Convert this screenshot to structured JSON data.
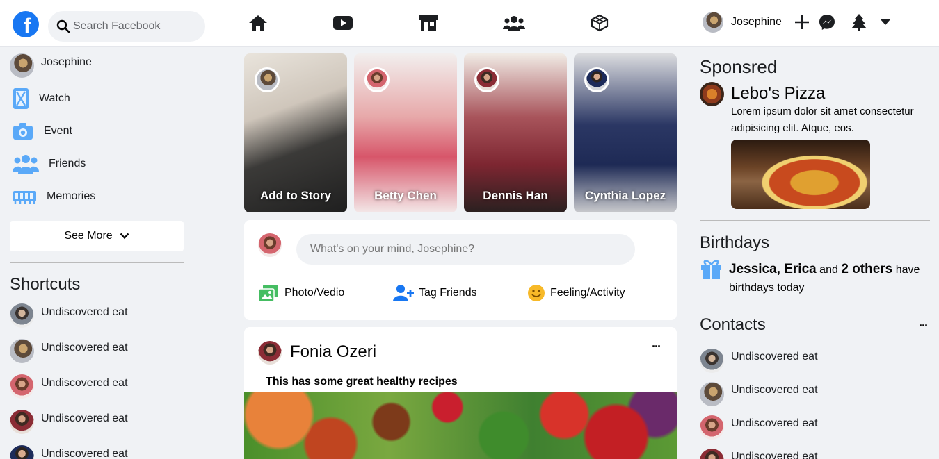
{
  "brand": {
    "logo_letter": "f",
    "color": "#1877f2"
  },
  "search": {
    "placeholder": "Search Facebook"
  },
  "nav": [
    {
      "icon": "home-icon"
    },
    {
      "icon": "video-icon"
    },
    {
      "icon": "marketplace-icon"
    },
    {
      "icon": "groups-icon"
    },
    {
      "icon": "gaming-icon"
    }
  ],
  "user": {
    "name": "Josephine"
  },
  "sidebar": {
    "items": [
      {
        "label": "Josephine",
        "icon": "avatar"
      },
      {
        "label": "Watch",
        "icon": "watch-icon"
      },
      {
        "label": "Event",
        "icon": "camera-icon"
      },
      {
        "label": "Friends",
        "icon": "friends-icon"
      },
      {
        "label": "Memories",
        "icon": "memories-icon"
      }
    ],
    "see_more": "See More",
    "shortcuts_title": "Shortcuts",
    "shortcuts": [
      {
        "label": "Undiscovered eat"
      },
      {
        "label": "Undiscovered eat"
      },
      {
        "label": "Undiscovered eat"
      },
      {
        "label": "Undiscovered eat"
      },
      {
        "label": "Undiscovered eat"
      }
    ]
  },
  "stories": [
    {
      "name": "Add to Story"
    },
    {
      "name": "Betty Chen"
    },
    {
      "name": "Dennis Han"
    },
    {
      "name": "Cynthia Lopez"
    }
  ],
  "composer": {
    "placeholder": "What's on your mind, Josephine?",
    "actions": [
      {
        "label": "Photo/Vedio",
        "icon": "photo-icon",
        "color": "#45bd62"
      },
      {
        "label": "Tag Friends",
        "icon": "tag-friends-icon",
        "color": "#1877f2"
      },
      {
        "label": "Feeling/Activity",
        "icon": "feeling-icon",
        "color": "#f7b928"
      }
    ]
  },
  "post": {
    "author": "Fonia Ozeri",
    "text": "This has some great healthy recipes",
    "more": "···"
  },
  "sponsored": {
    "title": "Sponsred",
    "name": "Lebo's Pizza",
    "text": "Lorem ipsum dolor sit amet consectetur adipisicing elit. Atque, eos."
  },
  "birthdays": {
    "title": "Birthdays",
    "names": "Jessica, Erica",
    "and": "and",
    "others": "2 others",
    "have": "have",
    "rest": "birthdays today"
  },
  "contacts": {
    "title": "Contacts",
    "more": "···",
    "items": [
      {
        "label": "Undiscovered eat"
      },
      {
        "label": "Undiscovered eat"
      },
      {
        "label": "Undiscovered eat"
      },
      {
        "label": "Undiscovered eat"
      }
    ]
  }
}
